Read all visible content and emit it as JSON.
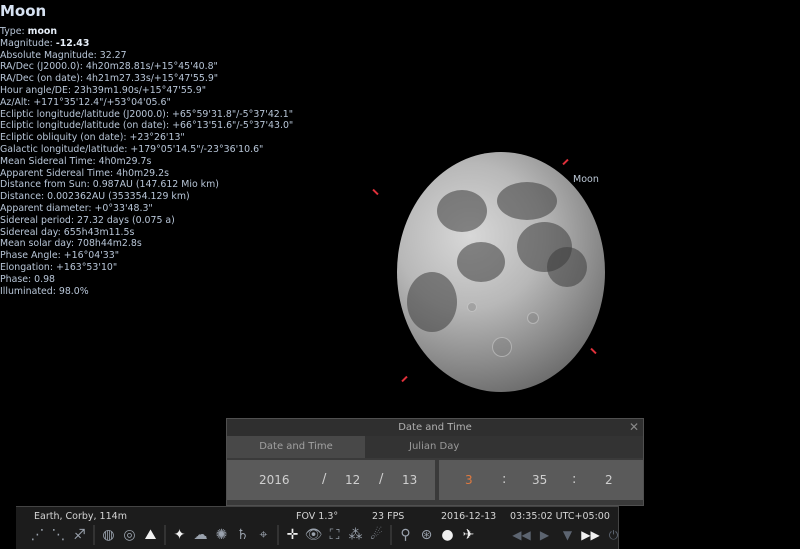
{
  "object": {
    "name": "Moon"
  },
  "info_lines": [
    {
      "label": "Type: ",
      "value": "moon",
      "bold": true
    },
    {
      "label": "Magnitude: ",
      "value": "-12.43",
      "bold": true
    },
    {
      "label": "Absolute Magnitude: ",
      "value": "32.27"
    },
    {
      "label": "RA/Dec (J2000.0): ",
      "value": "4h20m28.81s/+15°45'40.8\""
    },
    {
      "label": "RA/Dec (on date): ",
      "value": "4h21m27.33s/+15°47'55.9\""
    },
    {
      "label": "Hour angle/DE: ",
      "value": "23h39m1.90s/+15°47'55.9\""
    },
    {
      "label": "Az/Alt: ",
      "value": "+171°35'12.4\"/+53°04'05.6\""
    },
    {
      "label": "Ecliptic longitude/latitude (J2000.0): ",
      "value": "+65°59'31.8\"/-5°37'42.1\""
    },
    {
      "label": "Ecliptic longitude/latitude (on date): ",
      "value": "+66°13'51.6\"/-5°37'43.0\""
    },
    {
      "label": "Ecliptic obliquity (on date): ",
      "value": "+23°26'13\""
    },
    {
      "label": "Galactic longitude/latitude: ",
      "value": "+179°05'14.5\"/-23°36'10.6\""
    },
    {
      "label": "Mean Sidereal Time: ",
      "value": "4h0m29.7s"
    },
    {
      "label": "Apparent Sidereal Time: ",
      "value": "4h0m29.2s"
    },
    {
      "label": "Distance from Sun: ",
      "value": "0.987AU (147.612 Mio km)"
    },
    {
      "label": "Distance: ",
      "value": "0.002362AU (353354.129 km)"
    },
    {
      "label": "Apparent diameter: ",
      "value": "+0°33'48.3\""
    },
    {
      "label": "Sidereal period: ",
      "value": "27.32 days (0.075 a)"
    },
    {
      "label": "Sidereal day: ",
      "value": "655h43m11.5s"
    },
    {
      "label": "Mean solar day: ",
      "value": "708h44m2.8s"
    },
    {
      "label": "Phase Angle: ",
      "value": "+16°04'33\""
    },
    {
      "label": "Elongation: ",
      "value": "+163°53'10\""
    },
    {
      "label": "Phase: ",
      "value": "0.98"
    },
    {
      "label": "Illuminated: ",
      "value": "98.0%"
    }
  ],
  "sky_label": "Moon",
  "dialog": {
    "title": "Date and Time",
    "close": "✕",
    "tabs": [
      "Date and Time",
      "Julian Day"
    ],
    "year": "2016",
    "month": "12",
    "day": "13",
    "hour": "3",
    "minute": "35",
    "second": "2",
    "date_sep": "/",
    "time_sep": ":"
  },
  "status": {
    "location": "Earth, Corby, 114m",
    "fov": "FOV 1.3°",
    "fps": "23 FPS",
    "date": "2016-12-13",
    "time": "03:35:02 UTC+05:00"
  },
  "toolbar_icons": [
    {
      "icon": "constellation-lines-icon",
      "glyph": "⋰"
    },
    {
      "icon": "constellation-labels-icon",
      "glyph": "⋱"
    },
    {
      "icon": "constellation-art-icon",
      "glyph": "♐"
    },
    {
      "icon": "equatorial-grid-icon",
      "glyph": "◍"
    },
    {
      "icon": "azimuthal-grid-icon",
      "glyph": "◎"
    },
    {
      "icon": "ground-icon",
      "glyph": "⛰"
    },
    {
      "icon": "cardinal-points-icon",
      "glyph": "✦"
    },
    {
      "icon": "atmosphere-icon",
      "glyph": "☁"
    },
    {
      "icon": "nebulae-icon",
      "glyph": "✺"
    },
    {
      "icon": "planets-labels-icon",
      "glyph": "♄"
    },
    {
      "icon": "equatorial-mount-icon",
      "glyph": "⌖"
    },
    {
      "icon": "center-object-icon",
      "glyph": "✛"
    },
    {
      "icon": "night-mode-icon",
      "glyph": "👁"
    },
    {
      "icon": "fullscreen-icon",
      "glyph": "⛶"
    },
    {
      "icon": "satellites-icon",
      "glyph": "⁂"
    },
    {
      "icon": "meteor-icon",
      "glyph": "☄"
    },
    {
      "icon": "telescope-icon",
      "glyph": "⚲"
    },
    {
      "icon": "exoplanets-icon",
      "glyph": "⊛"
    },
    {
      "icon": "ocular-icon",
      "glyph": "●"
    },
    {
      "icon": "satellite-plugin-icon",
      "glyph": "✈"
    }
  ],
  "time_controls": [
    {
      "icon": "rewind-icon",
      "glyph": "◀◀"
    },
    {
      "icon": "play-icon",
      "glyph": "▶"
    },
    {
      "icon": "now-icon",
      "glyph": "▼"
    },
    {
      "icon": "fast-forward-icon",
      "glyph": "▶▶"
    },
    {
      "icon": "quit-icon",
      "glyph": "⏻"
    }
  ]
}
